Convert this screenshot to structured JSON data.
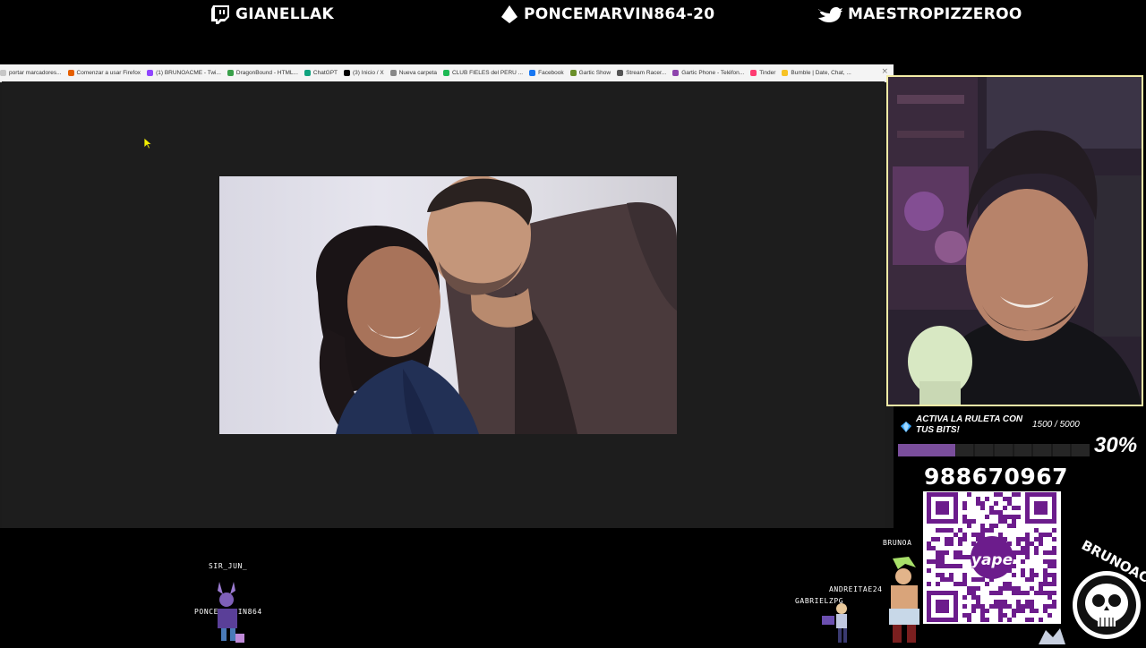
{
  "social": [
    {
      "icon": "twitch-icon",
      "handle": "GIANELLAK"
    },
    {
      "icon": "kick-icon",
      "handle": "PONCEMARVIN864-20"
    },
    {
      "icon": "twitter-bird-icon",
      "handle": "MAESTROPIZZEROO"
    }
  ],
  "browser": {
    "bookmarks": [
      {
        "label": "portar marcadores...",
        "color": "#c7c7c7"
      },
      {
        "label": "Comenzar a usar Firefox",
        "color": "#e66000"
      },
      {
        "label": "(1) BRUNOACME - Twi...",
        "color": "#9146ff"
      },
      {
        "label": "DragonBound - HTML...",
        "color": "#3aa04a"
      },
      {
        "label": "ChatGPT",
        "color": "#10a37f"
      },
      {
        "label": "(3) Inicio / X",
        "color": "#000000"
      },
      {
        "label": "Nueva carpeta",
        "color": "#888888"
      },
      {
        "label": "CLUB FIELES del PERU ...",
        "color": "#1db954"
      },
      {
        "label": "Facebook",
        "color": "#1877f2"
      },
      {
        "label": "Gartic Show",
        "color": "#6a8f2a"
      },
      {
        "label": "Stream Racer...",
        "color": "#555555"
      },
      {
        "label": "Gartic Phone - Teléfon...",
        "color": "#8e44ad"
      },
      {
        "label": "Tinder",
        "color": "#fe3c72"
      },
      {
        "label": "Bumble | Date, Chat, ...",
        "color": "#f7c325"
      }
    ],
    "close_glyph": "×"
  },
  "bits_goal": {
    "title": "ACTIVA LA RULETA CON TUS BITS!",
    "count": "1500 / 5000",
    "percent_label": "30%",
    "progress": 0.3,
    "accent": "#7a4e9c"
  },
  "yape": {
    "phone": "988670967",
    "brand": "yape",
    "color": "#6c1c8c"
  },
  "chat_users": [
    {
      "name": "SIR_JUN_"
    },
    {
      "name": "PONCEMARVIN864"
    },
    {
      "name": "BRUNOA"
    },
    {
      "name": "ANDREITAE24"
    },
    {
      "name": "GABRIELZPG"
    }
  ],
  "logo": {
    "text": "BRUNOACME"
  }
}
